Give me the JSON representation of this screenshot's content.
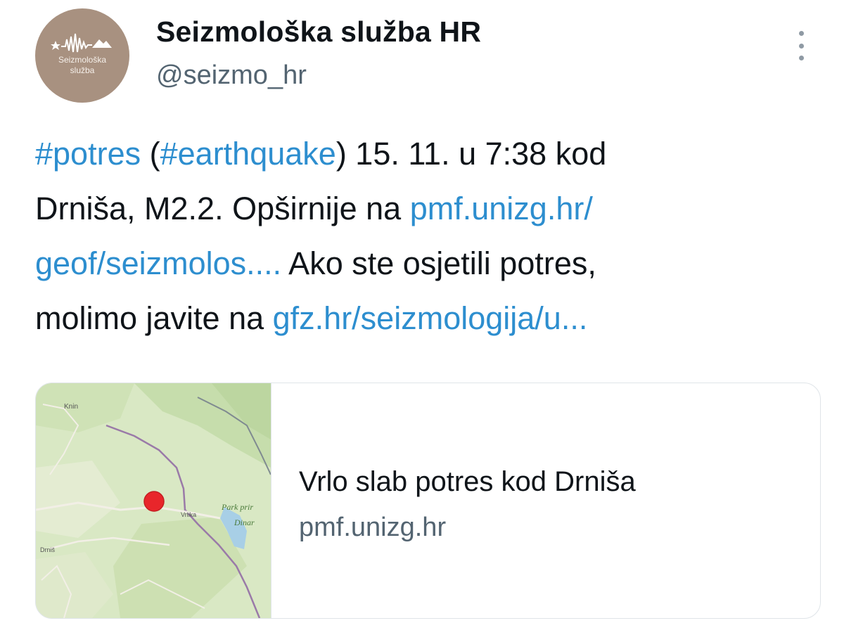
{
  "account": {
    "display_name": "Seizmološka služba HR",
    "handle": "@seizmo_hr",
    "avatar_lines": [
      "Seizmološka",
      "služba"
    ]
  },
  "tweet": {
    "hashtag_potres": "#potres",
    "open_paren": " (",
    "hashtag_earthquake": "#earthquake",
    "after_hashtags": ") 15. 11. u 7:38 kod",
    "line2_text": "Drniša, M2.2. Opširnije na ",
    "link1_part1": "pmf.unizg.hr/",
    "link1_part2": "geof/seizmolos....",
    "line3_text": " Ako ste osjetili potres,",
    "line4_text": "molimo javite na  ",
    "link2": "gfz.hr/seizmologija/u..."
  },
  "card": {
    "title": "Vrlo slab potres kod Drniša",
    "domain": "pmf.unizg.hr",
    "map_labels": {
      "town1": "Knin",
      "town2": "Vrlika",
      "park_line1": "Park prir",
      "park_line2": "Dinar",
      "town3": "Drniš"
    }
  },
  "colors": {
    "link": "#2d8ecf",
    "avatar_bg": "#a89180",
    "map_land": "#d9e8c4",
    "epicenter": "#e8262b"
  },
  "icons": {
    "more": "more-vertical-icon",
    "avatar_logo": "seismograph-logo-icon"
  }
}
